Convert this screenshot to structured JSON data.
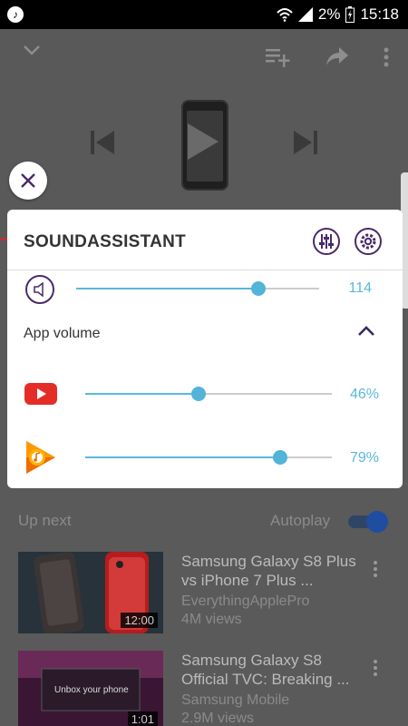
{
  "status_bar": {
    "battery_percent": "2%",
    "time": "15:18",
    "notification_icon": "music-note-icon"
  },
  "player": {
    "icons": [
      "chevron-down-icon",
      "add-to-playlist-icon",
      "share-icon",
      "more-vert-icon",
      "previous-icon",
      "play-icon",
      "next-icon"
    ]
  },
  "sound_assistant": {
    "title": "SOUNDASSISTANT",
    "master_volume": {
      "value_label": "114",
      "level": 0.75
    },
    "app_volume_label": "App volume",
    "apps": [
      {
        "icon": "youtube-icon",
        "value_label": "46%",
        "level": 0.46
      },
      {
        "icon": "google-play-music-icon",
        "value_label": "79%",
        "level": 0.79
      }
    ]
  },
  "up_next": {
    "label": "Up next",
    "autoplay_label": "Autoplay",
    "autoplay_on": true
  },
  "videos": [
    {
      "title": "Samsung Galaxy S8 Plus vs iPhone 7 Plus ...",
      "channel": "EverythingApplePro",
      "views": "4M views",
      "duration": "12:00"
    },
    {
      "title": "Samsung Galaxy S8 Official TVC: Breaking ...",
      "channel": "Samsung Mobile",
      "views": "2.9M views",
      "duration": "1:01",
      "thumb_text": "Unbox your phone"
    }
  ],
  "colors": {
    "accent": "#5ab8d9",
    "purple": "#4a2a6a",
    "youtube_red": "#e52d27"
  }
}
